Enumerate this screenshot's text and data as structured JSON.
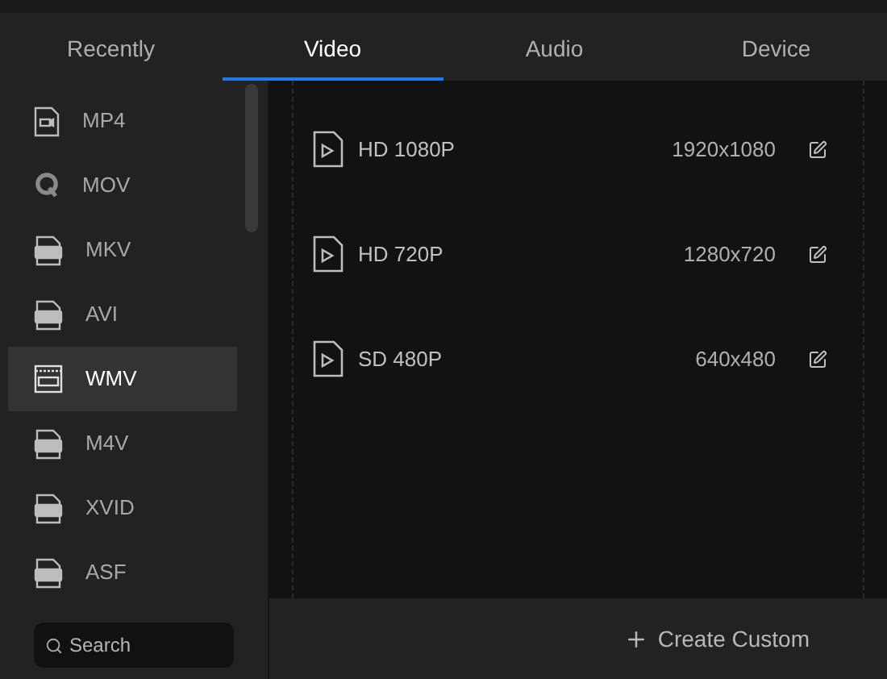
{
  "tabs": [
    {
      "label": "Recently",
      "selected": false
    },
    {
      "label": "Video",
      "selected": true
    },
    {
      "label": "Audio",
      "selected": false
    },
    {
      "label": "Device",
      "selected": false
    }
  ],
  "formats": [
    {
      "label": "MP4",
      "kind": "video",
      "selected": false
    },
    {
      "label": "MOV",
      "kind": "quicktime",
      "selected": false
    },
    {
      "label": "MKV",
      "kind": "tagged",
      "selected": false
    },
    {
      "label": "AVI",
      "kind": "tagged",
      "selected": false
    },
    {
      "label": "WMV",
      "kind": "window",
      "selected": true
    },
    {
      "label": "M4V",
      "kind": "tagged",
      "selected": false
    },
    {
      "label": "XVID",
      "kind": "tagged",
      "selected": false
    },
    {
      "label": "ASF",
      "kind": "tagged",
      "selected": false
    }
  ],
  "search": {
    "placeholder": "Search"
  },
  "presets": [
    {
      "name": "HD 1080P",
      "resolution": "1920x1080"
    },
    {
      "name": "HD 720P",
      "resolution": "1280x720"
    },
    {
      "name": "SD 480P",
      "resolution": "640x480"
    }
  ],
  "create_button": {
    "label": "Create Custom"
  }
}
